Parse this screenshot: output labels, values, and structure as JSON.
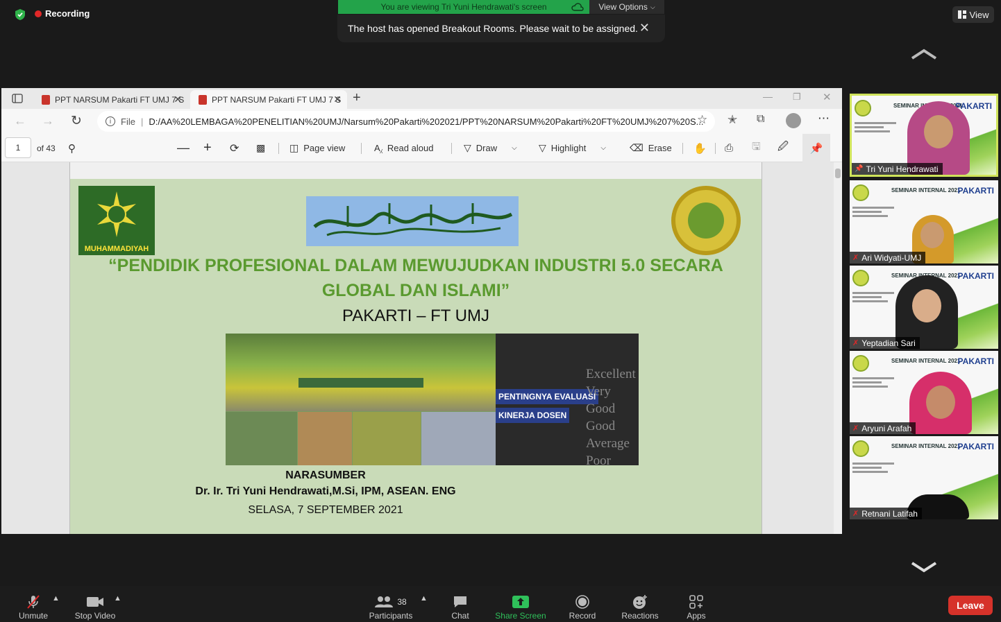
{
  "zoom": {
    "recording_label": "Recording",
    "viewing_banner": "You are viewing Tri Yuni Hendrawati's screen",
    "view_options_label": "View Options",
    "notice_text": "The host has opened Breakout Rooms. Please wait to be assigned.",
    "view_button_label": "View"
  },
  "browser": {
    "tabs": [
      {
        "label": "PPT NARSUM Pakarti FT UMJ 7 S"
      },
      {
        "label": "PPT NARSUM Pakarti FT UMJ 7 S"
      }
    ],
    "file_label": "File",
    "url": "D:/AA%20LEMBAGA%20PENELITIAN%20UMJ/Narsum%20Pakarti%202021/PPT%20NARSUM%20Pakarti%20FT%20UMJ%207%20S...",
    "page_current": "1",
    "page_total": "of 43",
    "page_view_label": "Page view",
    "read_aloud_label": "Read aloud",
    "draw_label": "Draw",
    "highlight_label": "Highlight",
    "erase_label": "Erase"
  },
  "slide": {
    "logo_left_label": "MUHAMMADIYAH",
    "title_line1": "“PENDIDIK PROFESIONAL DALAM MEWUJUDKAN INDUSTRI 5.0 SECARA",
    "title_line2": "GLOBAL DAN ISLAMI”",
    "subtitle": "PAKARTI – FT UMJ",
    "kinerja_line1": "PENTINGNYA EVALUASI",
    "kinerja_line2": "KINERJA DOSEN",
    "ratings": [
      "Excellent",
      "Very Good",
      "Good",
      "Average",
      "Poor"
    ],
    "narasumber_label": "NARASUMBER",
    "speaker": "Dr. Ir. Tri Yuni Hendrawati,M.Si, IPM, ASEAN. ENG",
    "date": "SELASA, 7 SEPTEMBER 2021"
  },
  "tiles": {
    "seminar_text": "SEMINAR INTERNAL 2021",
    "pakarti_text": "PAKARTI",
    "participants": [
      {
        "name": "Tri Yuni Hendrawati",
        "active": true
      },
      {
        "name": "Ari Widyati-UMJ",
        "active": false
      },
      {
        "name": "Yeptadian Sari",
        "active": false
      },
      {
        "name": "Aryuni Arafah",
        "active": false
      },
      {
        "name": "Retnani Latifah",
        "active": false
      }
    ]
  },
  "toolbar": {
    "unmute_label": "Unmute",
    "stop_video_label": "Stop Video",
    "participants_label": "Participants",
    "participants_count": "38",
    "chat_label": "Chat",
    "share_screen_label": "Share Screen",
    "record_label": "Record",
    "reactions_label": "Reactions",
    "apps_label": "Apps",
    "leave_label": "Leave"
  },
  "colors": {
    "share_green": "#23a34a",
    "leave_red": "#d6322a",
    "slide_green_text": "#5a9a2f",
    "active_tile_border": "#cfe35a"
  }
}
